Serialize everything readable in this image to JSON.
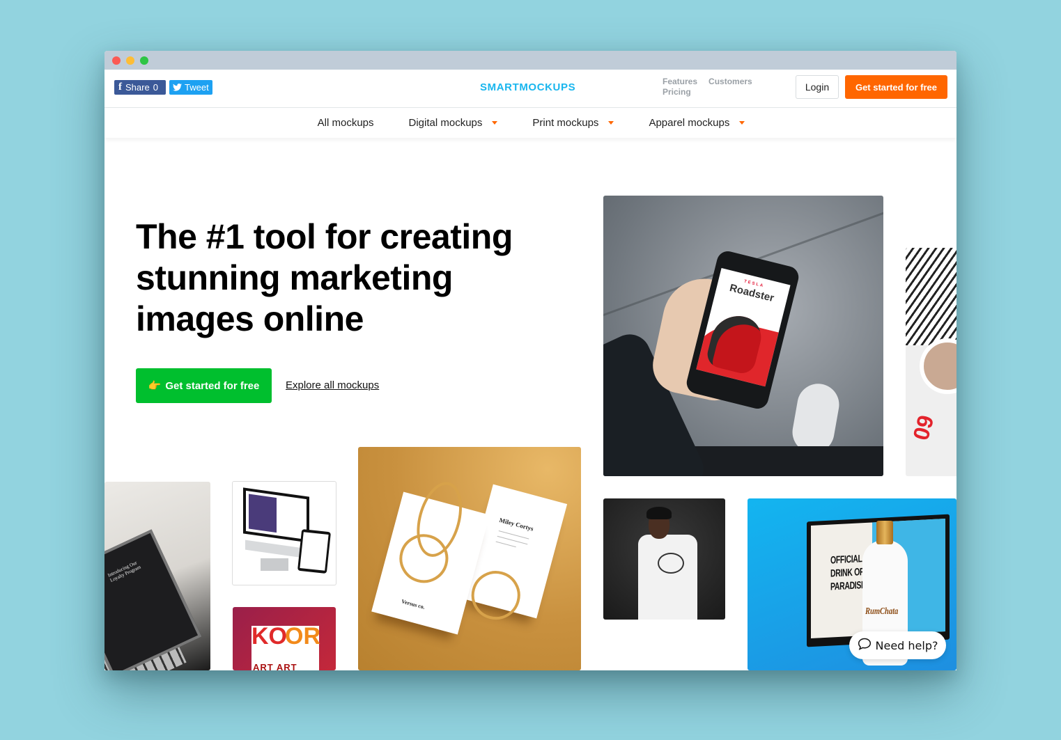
{
  "window": {
    "controls": [
      "close",
      "minimize",
      "maximize"
    ]
  },
  "topbar": {
    "share": {
      "icon": "facebook-icon",
      "label": "Share",
      "count": "0"
    },
    "tweet": {
      "icon": "twitter-icon",
      "label": "Tweet"
    },
    "logo": "SMARTMOCKUPS",
    "links": [
      "Features",
      "Customers",
      "Pricing"
    ],
    "login_label": "Login",
    "cta_label": "Get started for free"
  },
  "categories": [
    {
      "label": "All mockups",
      "has_dropdown": false
    },
    {
      "label": "Digital mockups",
      "has_dropdown": true
    },
    {
      "label": "Print mockups",
      "has_dropdown": true
    },
    {
      "label": "Apparel mockups",
      "has_dropdown": true
    }
  ],
  "hero": {
    "title": "The #1 tool for creating stunning marketing images online",
    "cta_icon": "👉",
    "cta_label": "Get started for free",
    "explore_label": "Explore all mockups"
  },
  "tiles": {
    "phone": {
      "brand": "TESLA",
      "model": "Roadster"
    },
    "magazine": {
      "number": "09"
    },
    "laptop": {
      "text": "Introducing Our Loyalty Program"
    },
    "art": {
      "letters_1": "KO",
      "letters_2": "OR",
      "line": "ART ART"
    },
    "cards": {
      "name": "Miley Cortys",
      "company": "Versus co."
    },
    "monitor": {
      "headline_1": "OFFICIAL",
      "headline_2": "DRINK OF",
      "headline_3": "PARADISE",
      "brand": "RumChata"
    }
  },
  "help": {
    "icon": "chat-bubble-icon",
    "label": "Need help?"
  },
  "colors": {
    "brand": "#19b6ee",
    "cta_orange": "#ff6600",
    "cta_green": "#00bf2e",
    "facebook": "#3b5998",
    "twitter": "#1da1f2",
    "background": "#92d3df"
  }
}
